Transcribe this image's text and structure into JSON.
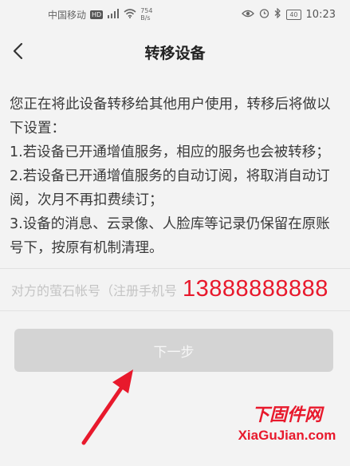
{
  "status_bar": {
    "carrier": "中国移动",
    "hd": "HD",
    "signal": "⁵⁶",
    "speed_value": "754",
    "speed_unit": "B/s",
    "battery": "40",
    "time": "10:23"
  },
  "nav": {
    "title": "转移设备"
  },
  "notice": {
    "intro": "您正在将此设备转移给其他用户使用，转移后将做以下设置：",
    "item1": "1.若设备已开通增值服务，相应的服务也会被转移；",
    "item2": "2.若设备已开通增值服务的自动订阅，将取消自动订阅，次月不再扣费续订；",
    "item3": "3.设备的消息、云录像、人脸库等记录仍保留在原账号下，按原有机制清理。"
  },
  "account_input": {
    "placeholder": "对方的萤石帐号（注册手机号",
    "value": "",
    "overlay_number": "13888888888"
  },
  "next_button": {
    "label": "下一步"
  },
  "watermark": {
    "cn": "下固件网",
    "en": "XiaGuJian.com"
  },
  "colors": {
    "background": "#f3f3f3",
    "button_disabled": "#d4d4d4",
    "annotation_red": "#e8192c"
  }
}
